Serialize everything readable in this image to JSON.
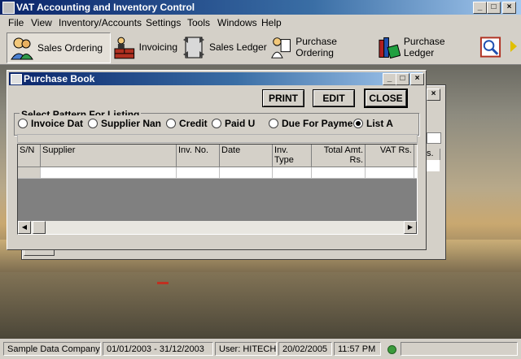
{
  "app": {
    "title": "VAT Accounting and Inventory Control"
  },
  "menu": [
    "File",
    "View",
    "Inventory/Accounts",
    "Settings",
    "Tools",
    "Windows",
    "Help"
  ],
  "toolbar": {
    "sales_ordering": "Sales Ordering",
    "invoicing": "Invoicing",
    "sales_ledger": "Sales Ledger",
    "purchase_ordering": "Purchase Ordering",
    "purchase_ledger": "Purchase Ledger"
  },
  "purchase_book": {
    "title": "Purchase Book",
    "print_label": "PRINT",
    "edit_label": "EDIT",
    "close_label": "CLOSE",
    "group_label": "Select Pattern For Listing",
    "radios": [
      {
        "label": "Invoice Dat",
        "selected": false
      },
      {
        "label": "Supplier Nan",
        "selected": false
      },
      {
        "label": "Credit",
        "selected": false
      },
      {
        "label": "Paid U",
        "selected": false
      },
      {
        "label": "Due For Payme",
        "selected": false
      },
      {
        "label": "List A",
        "selected": true
      }
    ],
    "columns": [
      "S/N",
      "Supplier",
      "Inv. No.",
      "Date",
      "Inv. Type",
      "Total Amt. Rs.",
      "VAT Rs."
    ],
    "partial_column": "s."
  },
  "status": {
    "company": "Sample Data Company",
    "period": "01/01/2003 - 31/12/2003",
    "user": "User: HITECH",
    "date": "20/02/2005",
    "time": "11:57 PM"
  },
  "colors": {
    "title_bar": "#0a246a",
    "face": "#d4d0c8",
    "status_led": "#3c9b3c"
  }
}
